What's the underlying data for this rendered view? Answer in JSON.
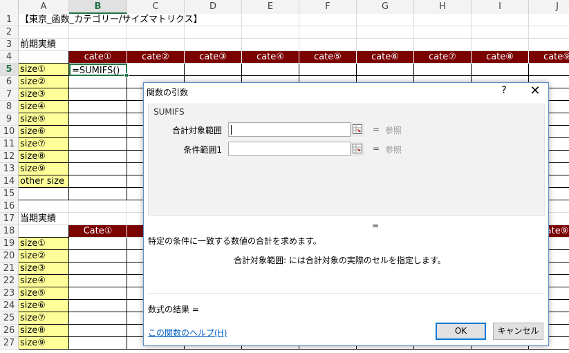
{
  "columns": [
    "A",
    "B",
    "C",
    "D",
    "E",
    "F",
    "G",
    "H",
    "I",
    "J"
  ],
  "rows": [
    "1",
    "2",
    "3",
    "4",
    "5",
    "6",
    "7",
    "8",
    "9",
    "10",
    "11",
    "12",
    "13",
    "14",
    "15",
    "16",
    "17",
    "18",
    "19",
    "20",
    "21",
    "22",
    "23",
    "24",
    "25",
    "26",
    "27"
  ],
  "title_cell": "【東京_函数_カテゴリー/サイズマトリクス】",
  "section_prev": "前期実績",
  "section_curr": "当期実績",
  "cate_headers_top": [
    "cate①",
    "cate②",
    "cate③",
    "cate④",
    "cate⑤",
    "cate⑥",
    "cate⑦",
    "cate⑧",
    "cate⑨"
  ],
  "cate_headers_bottom": [
    "Cate①",
    "ate⑨"
  ],
  "sizes_top": [
    "size①",
    "size②",
    "size③",
    "size④",
    "size⑤",
    "size⑥",
    "size⑦",
    "size⑧",
    "size⑨",
    "other size"
  ],
  "sizes_bottom": [
    "size①",
    "size②",
    "size③",
    "size④",
    "size⑤",
    "size⑥",
    "size⑦",
    "size⑧",
    "size⑨"
  ],
  "active_cell_formula": "=SUMIFS()",
  "colors": {
    "maroon": "#7b0000",
    "yellow": "#ffff99",
    "excel_green": "#217346",
    "link": "#0563c1"
  },
  "dialog": {
    "title": "関数の引数",
    "help_glyph": "?",
    "close_glyph": "✕",
    "function_name": "SUMIFS",
    "args": [
      {
        "label": "合計対象範囲",
        "value": "",
        "eq": "=",
        "result": "参照"
      },
      {
        "label": "条件範囲1",
        "value": "",
        "eq": "=",
        "result": "参照"
      }
    ],
    "result_eq": "=",
    "description": "特定の条件に一致する数値の合計を求めます。",
    "arg_description": "合計対象範囲:  には合計対象の実際のセルを指定します。",
    "formula_result": "数式の結果 =",
    "help_link": "この関数のヘルプ(H)",
    "ok_label": "OK",
    "cancel_label": "キャンセル"
  }
}
